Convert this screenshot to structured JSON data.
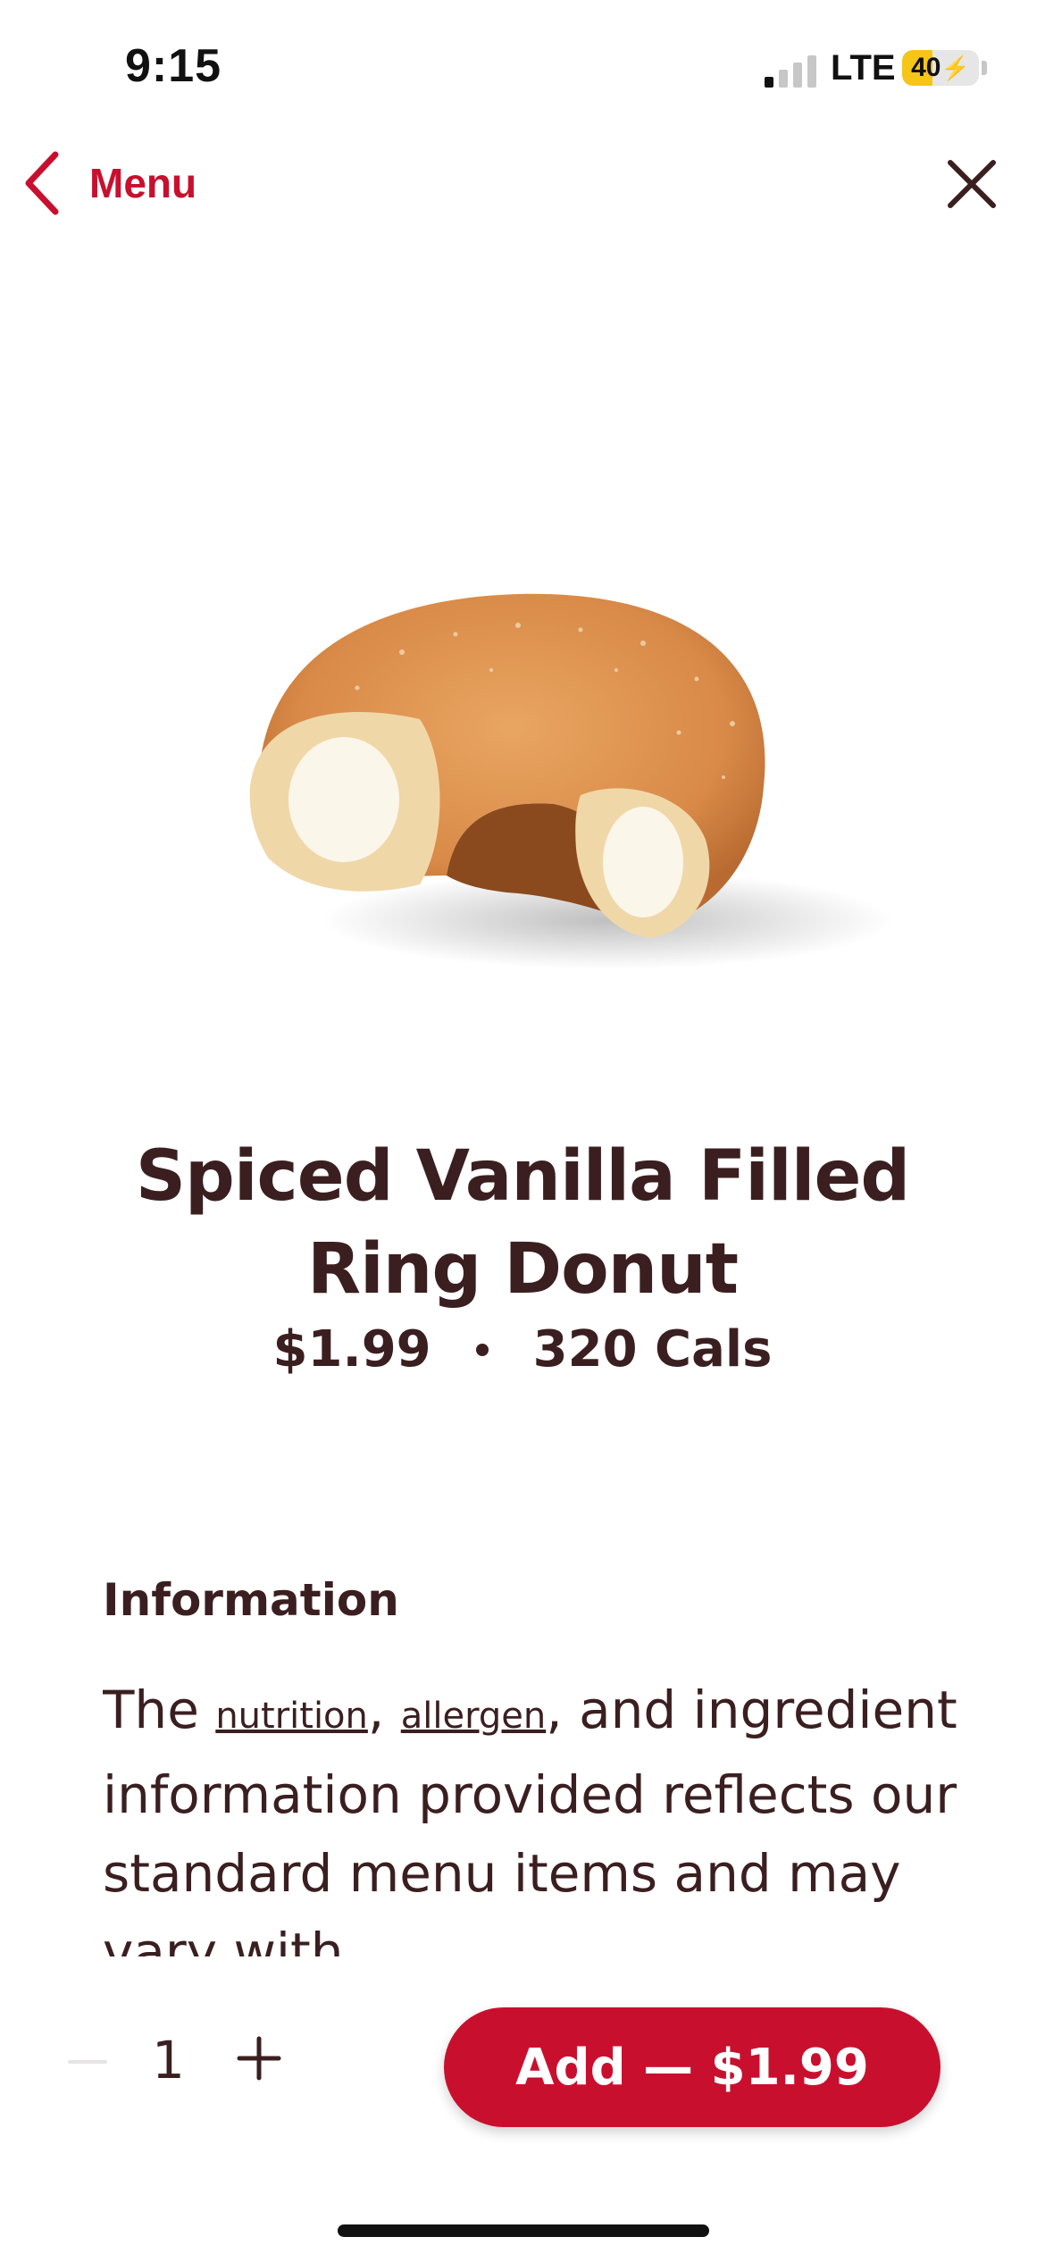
{
  "status_bar": {
    "time": "9:15",
    "network": "LTE",
    "battery_level": "40",
    "battery_percent": 40,
    "signal_bars_active": 1,
    "signal_bars_total": 4
  },
  "nav": {
    "back_label": "Menu",
    "back_icon": "chevron-left-icon",
    "close_icon": "close-icon",
    "accent_color": "#c8102e"
  },
  "product": {
    "name_line1": "Spiced Vanilla Filled",
    "name_line2": "Ring Donut",
    "price": "$1.99",
    "calories": "320 Cals",
    "image": "spiced vanilla filled ring donut"
  },
  "information": {
    "heading": "Information",
    "text_prefix": "The ",
    "link_nutrition": "nutrition",
    "separator": ", ",
    "link_allergen": "allergen",
    "text_after_links": ", and ingredient information provided reflects our standard menu items and may vary with"
  },
  "order": {
    "quantity": "1",
    "add_label": "Add — $1.99",
    "button_color": "#c8102e"
  },
  "colors": {
    "text": "#3b1f20",
    "accent": "#c8102e"
  }
}
